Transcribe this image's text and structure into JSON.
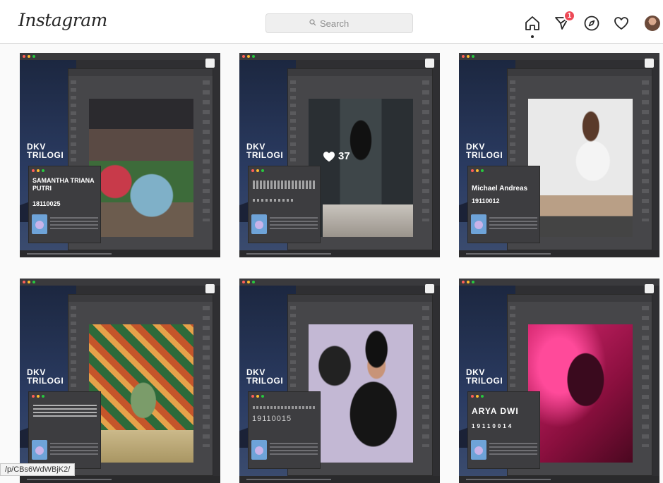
{
  "header": {
    "logo": "Instagram",
    "search_placeholder": "Search",
    "direct_badge": "1"
  },
  "posts": [
    {
      "brand": "DKV TRILOGI",
      "name": "SAMANTHA TRIANA PUTRI",
      "nim": "18110025",
      "likes": ""
    },
    {
      "brand": "DKV TRILOGI",
      "name": "",
      "nim": "",
      "likes": "37"
    },
    {
      "brand": "DKV TRILOGI",
      "name": "Michael Andreas",
      "nim": "19110012",
      "likes": ""
    },
    {
      "brand": "DKV TRILOGI",
      "name": "",
      "nim": "",
      "likes": ""
    },
    {
      "brand": "DKV TRILOGI",
      "name": "",
      "nim": "19110015",
      "likes": ""
    },
    {
      "brand": "DKV TRILOGI",
      "name": "ARYA DWI",
      "nim": "19110014",
      "likes": ""
    }
  ],
  "status_url": "/p/CBs6WdWBjK2/",
  "colors": {
    "badge": "#ed4956",
    "ps_panel": "#464649"
  }
}
